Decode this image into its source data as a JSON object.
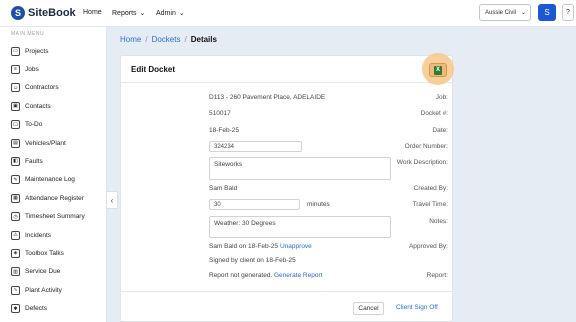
{
  "app": {
    "logo_letter": "S",
    "name": "SiteBook"
  },
  "topnav": {
    "home": "Home",
    "reports": "Reports",
    "admin": "Admin",
    "tenant": "Aussie Civil",
    "avatar": "S",
    "help": "?"
  },
  "sidebar": {
    "title": "MAIN MENU",
    "items": [
      {
        "label": "Projects",
        "icon": "folder-icon"
      },
      {
        "label": "Jobs",
        "icon": "list-icon"
      },
      {
        "label": "Contractors",
        "icon": "contractor-icon"
      },
      {
        "label": "Contacts",
        "icon": "contact-card-icon"
      },
      {
        "label": "To-Do",
        "icon": "todo-icon"
      },
      {
        "label": "Vehicles/Plant",
        "icon": "truck-icon"
      },
      {
        "label": "Faults",
        "icon": "fault-icon"
      },
      {
        "label": "Maintenance Log",
        "icon": "wrench-icon"
      },
      {
        "label": "Attendance Register",
        "icon": "attendance-icon"
      },
      {
        "label": "Timesheet Summary",
        "icon": "clock-icon"
      },
      {
        "label": "Incidents",
        "icon": "incident-icon"
      },
      {
        "label": "Toolbox Talks",
        "icon": "megaphone-icon"
      },
      {
        "label": "Service Due",
        "icon": "calendar-icon"
      },
      {
        "label": "Plant Activity",
        "icon": "activity-icon"
      },
      {
        "label": "Defects",
        "icon": "defect-icon"
      }
    ]
  },
  "breadcrumb": {
    "home": "Home",
    "dockets": "Dockets",
    "current": "Details",
    "sep": "/"
  },
  "card": {
    "title": "Edit Docket",
    "fields": {
      "job_label": "Job:",
      "job_value": "D113 - 260 Pavement Place, ADELAIDE",
      "docket_label": "Docket #:",
      "docket_value": "510017",
      "date_label": "Date:",
      "date_value": "18-Feb-25",
      "order_label": "Order Number:",
      "order_value": "324234",
      "work_label": "Work Description:",
      "work_value": "Siteworks",
      "created_label": "Created By:",
      "created_value": "Sam Bald",
      "travel_label": "Travel Time:",
      "travel_value": "30",
      "travel_unit": "minutes",
      "notes_label": "Notes:",
      "notes_value": "Weather: 30 Degrees",
      "approved_label": "Approved By:",
      "approved_value": "Sam Bald on 18-Feb-25",
      "unapprove": "Unapprove",
      "signed_value": "Signed by client on 18-Feb-25",
      "report_label": "Report:",
      "report_value": "Report not generated.",
      "generate_report": "Generate Report"
    },
    "cancel": "Cancel",
    "client_sign_off": "Client Sign Off"
  }
}
